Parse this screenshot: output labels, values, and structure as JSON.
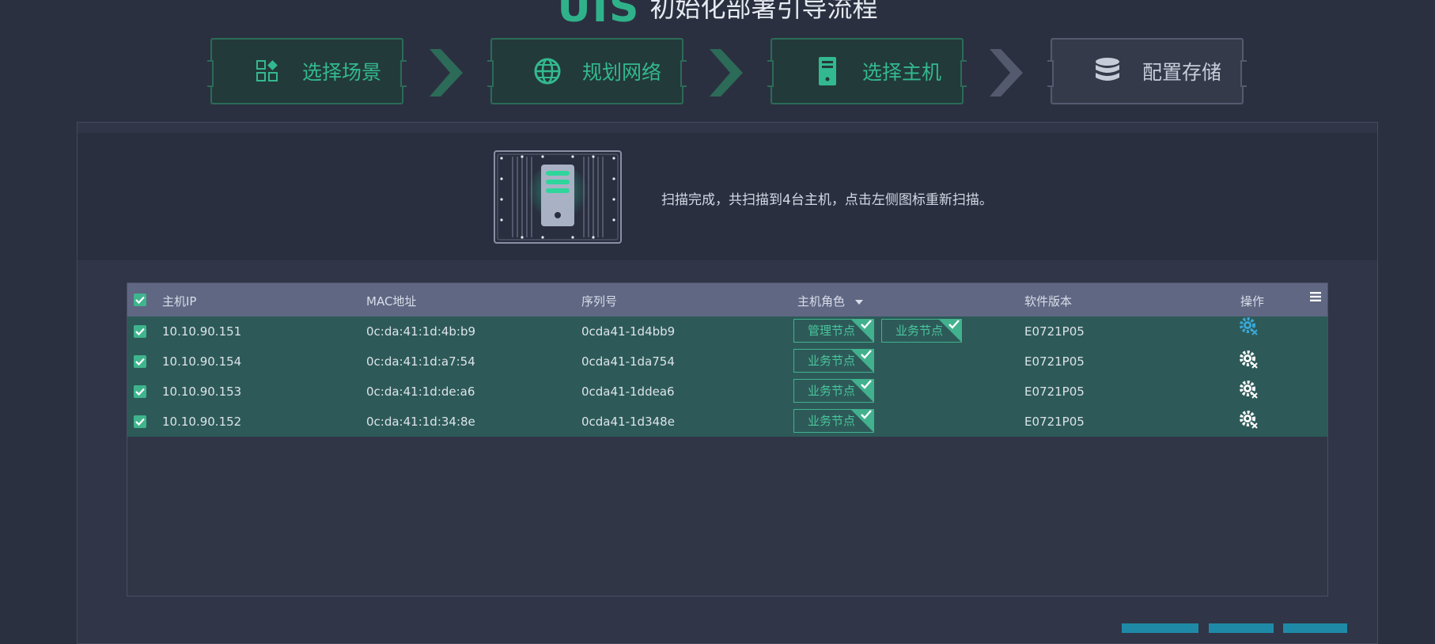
{
  "title": {
    "logo": "UIS",
    "text": "初始化部署引导流程"
  },
  "steps": [
    {
      "label": "选择场景",
      "icon": "scene-grid-icon",
      "state": "done"
    },
    {
      "label": "规划网络",
      "icon": "globe-icon",
      "state": "done"
    },
    {
      "label": "选择主机",
      "icon": "server-icon",
      "state": "active"
    },
    {
      "label": "配置存储",
      "icon": "database-icon",
      "state": "pending"
    }
  ],
  "scan": {
    "message": "扫描完成，共扫描到4台主机，点击左侧图标重新扫描。",
    "illustration": "server-scan-icon"
  },
  "table": {
    "headers": {
      "ip": "主机IP",
      "mac": "MAC地址",
      "serial": "序列号",
      "role": "主机角色",
      "version": "软件版本",
      "ops": "操作"
    },
    "rows": [
      {
        "checked": true,
        "ip": "10.10.90.151",
        "mac": "0c:da:41:1d:4b:b9",
        "serial": "0cda41-1d4bb9",
        "roles": [
          "管理节点",
          "业务节点"
        ],
        "version": "E0721P05",
        "op_icon": "gear-blue-icon"
      },
      {
        "checked": true,
        "ip": "10.10.90.154",
        "mac": "0c:da:41:1d:a7:54",
        "serial": "0cda41-1da754",
        "roles": [
          "业务节点"
        ],
        "version": "E0721P05",
        "op_icon": "gear-white-icon"
      },
      {
        "checked": true,
        "ip": "10.10.90.153",
        "mac": "0c:da:41:1d:de:a6",
        "serial": "0cda41-1ddea6",
        "roles": [
          "业务节点"
        ],
        "version": "E0721P05",
        "op_icon": "gear-white-icon"
      },
      {
        "checked": true,
        "ip": "10.10.90.152",
        "mac": "0c:da:41:1d:34:8e",
        "serial": "0cda41-1d348e",
        "roles": [
          "业务节点"
        ],
        "version": "E0721P05",
        "op_icon": "gear-white-icon"
      }
    ]
  },
  "colors": {
    "accent": "#33b98f",
    "row_bg": "#2d5a58",
    "header_bg": "#5f6783",
    "button": "#1f8aa8"
  }
}
